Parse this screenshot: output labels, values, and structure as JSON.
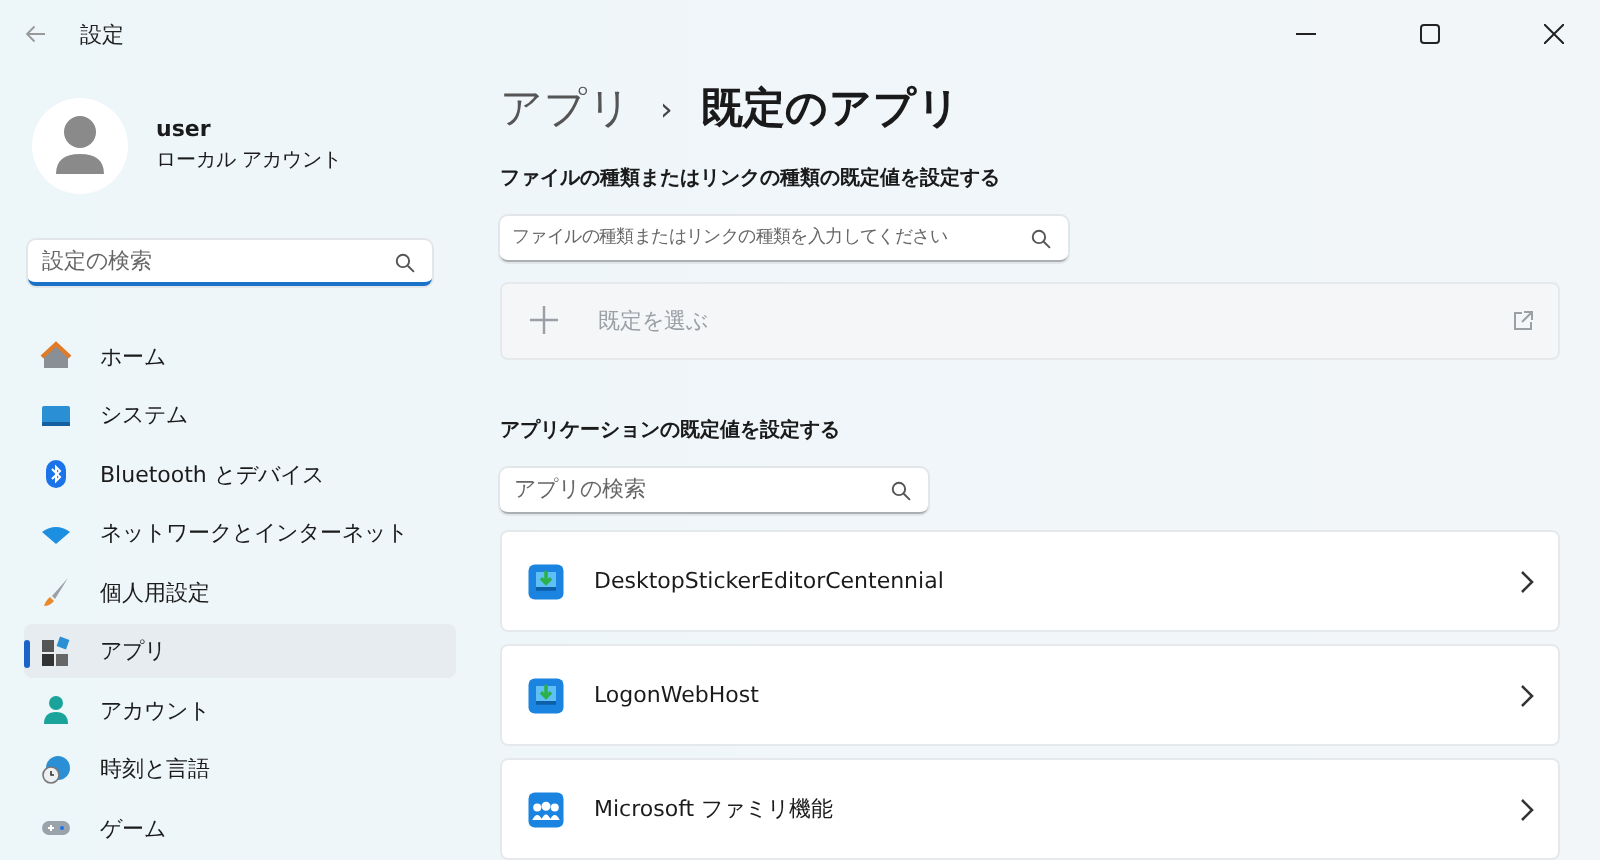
{
  "window": {
    "title": "設定"
  },
  "user": {
    "name": "user",
    "account": "ローカル アカウント"
  },
  "sidebar": {
    "search": {
      "placeholder": "設定の検索"
    },
    "items": [
      {
        "label": "ホーム",
        "kind": "home",
        "selected": false
      },
      {
        "label": "システム",
        "kind": "system",
        "selected": false
      },
      {
        "label": "Bluetooth とデバイス",
        "kind": "bluetooth",
        "selected": false
      },
      {
        "label": "ネットワークとインターネット",
        "kind": "network",
        "selected": false
      },
      {
        "label": "個人用設定",
        "kind": "brush",
        "selected": false
      },
      {
        "label": "アプリ",
        "kind": "apps",
        "selected": true
      },
      {
        "label": "アカウント",
        "kind": "account",
        "selected": false
      },
      {
        "label": "時刻と言語",
        "kind": "time",
        "selected": false
      },
      {
        "label": "ゲーム",
        "kind": "game",
        "selected": false
      }
    ]
  },
  "breadcrumb": {
    "parent": "アプリ",
    "separator": "›",
    "current": "既定のアプリ"
  },
  "file_section": {
    "heading": "ファイルの種類またはリンクの種類の既定値を設定する",
    "search": {
      "placeholder": "ファイルの種類またはリンクの種類を入力してください"
    },
    "choose": {
      "label": "既定を選ぶ",
      "disabled": true
    }
  },
  "app_section": {
    "heading": "アプリケーションの既定値を設定する",
    "search": {
      "placeholder": "アプリの検索"
    },
    "apps": [
      {
        "name": "DesktopStickerEditorCentennial",
        "kind": "installer"
      },
      {
        "name": "LogonWebHost",
        "kind": "installer"
      },
      {
        "name": "Microsoft ファミリ機能",
        "kind": "family"
      }
    ]
  }
}
